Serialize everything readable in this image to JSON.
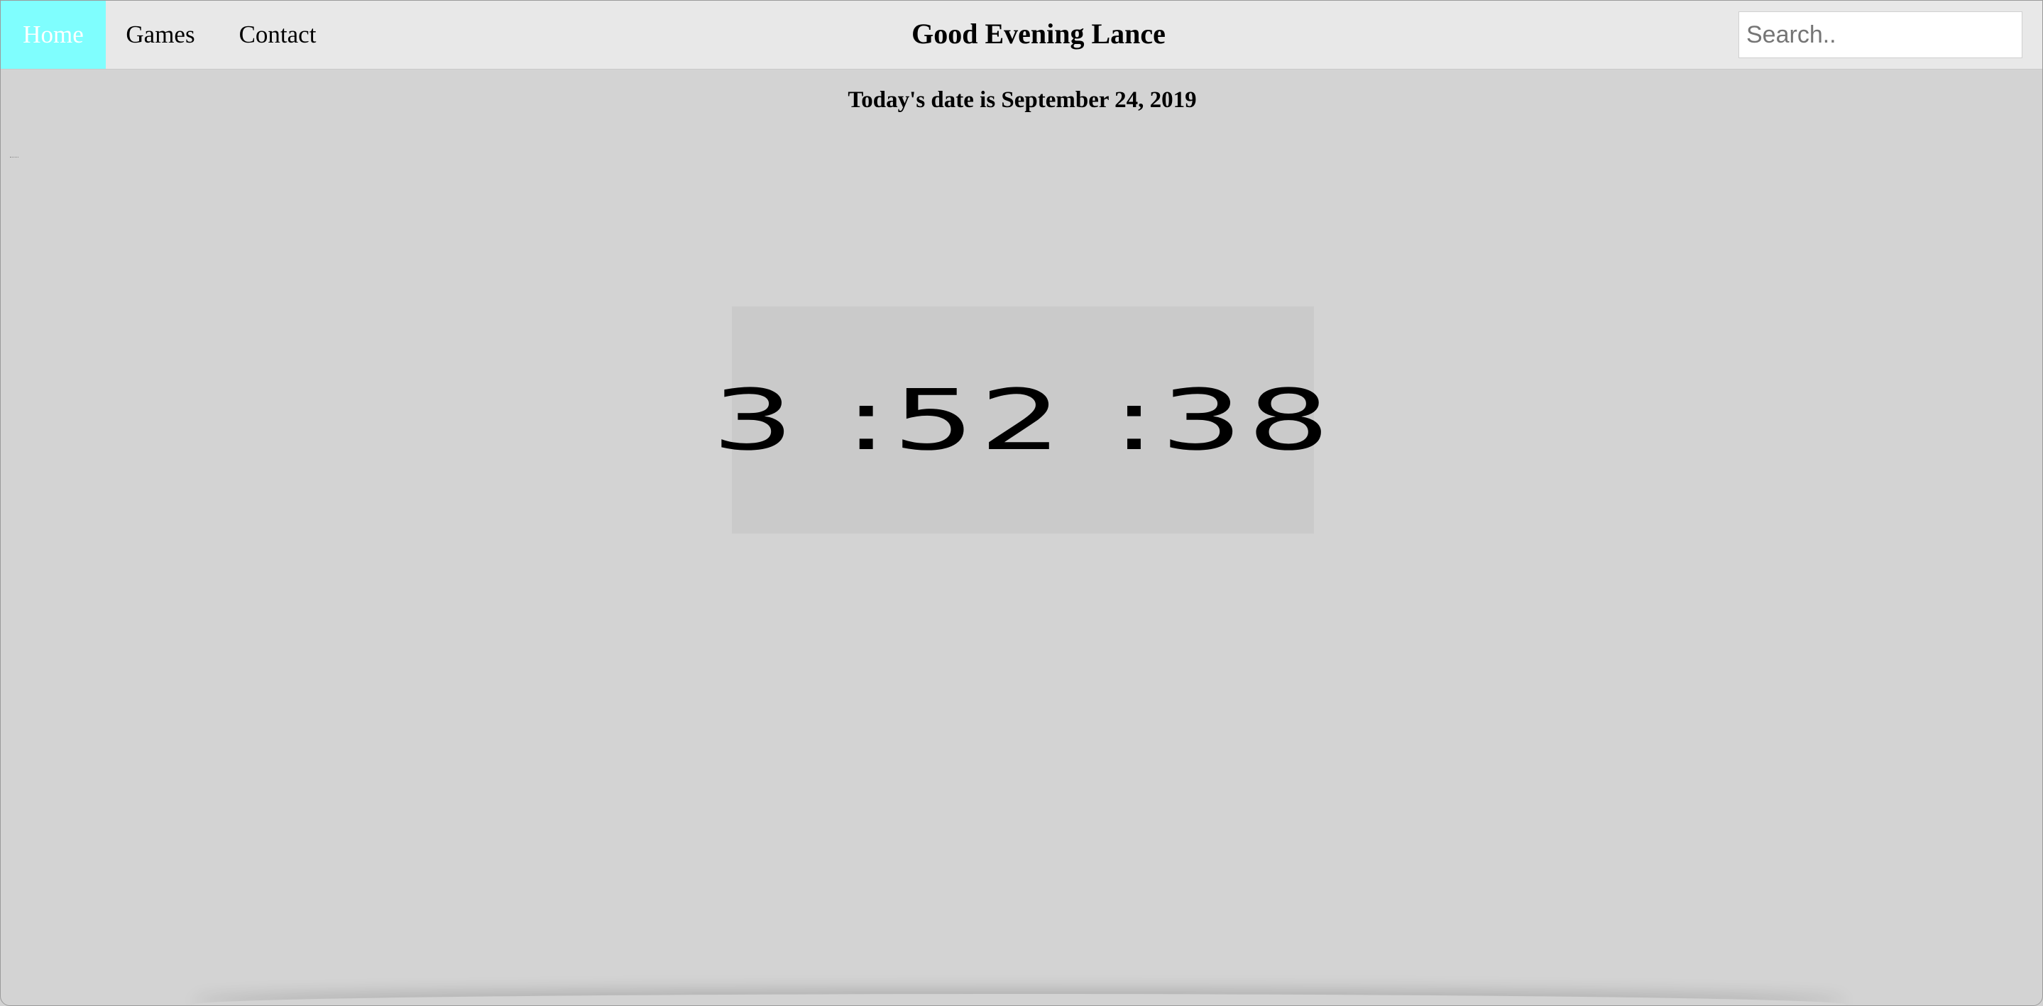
{
  "nav": {
    "home_label": "Home",
    "games_label": "Games",
    "contact_label": "Contact",
    "active_color": "#7ffefe"
  },
  "header": {
    "greeting": "Good Evening Lance"
  },
  "search": {
    "placeholder": "Search..",
    "value": ""
  },
  "main": {
    "date_text": "Today's date is September 24, 2019",
    "clock_time": "3 :52 :38"
  },
  "colors": {
    "background": "#d3d3d3",
    "navbar": "#e8e8e8",
    "clock_panel": "#cacaca"
  }
}
